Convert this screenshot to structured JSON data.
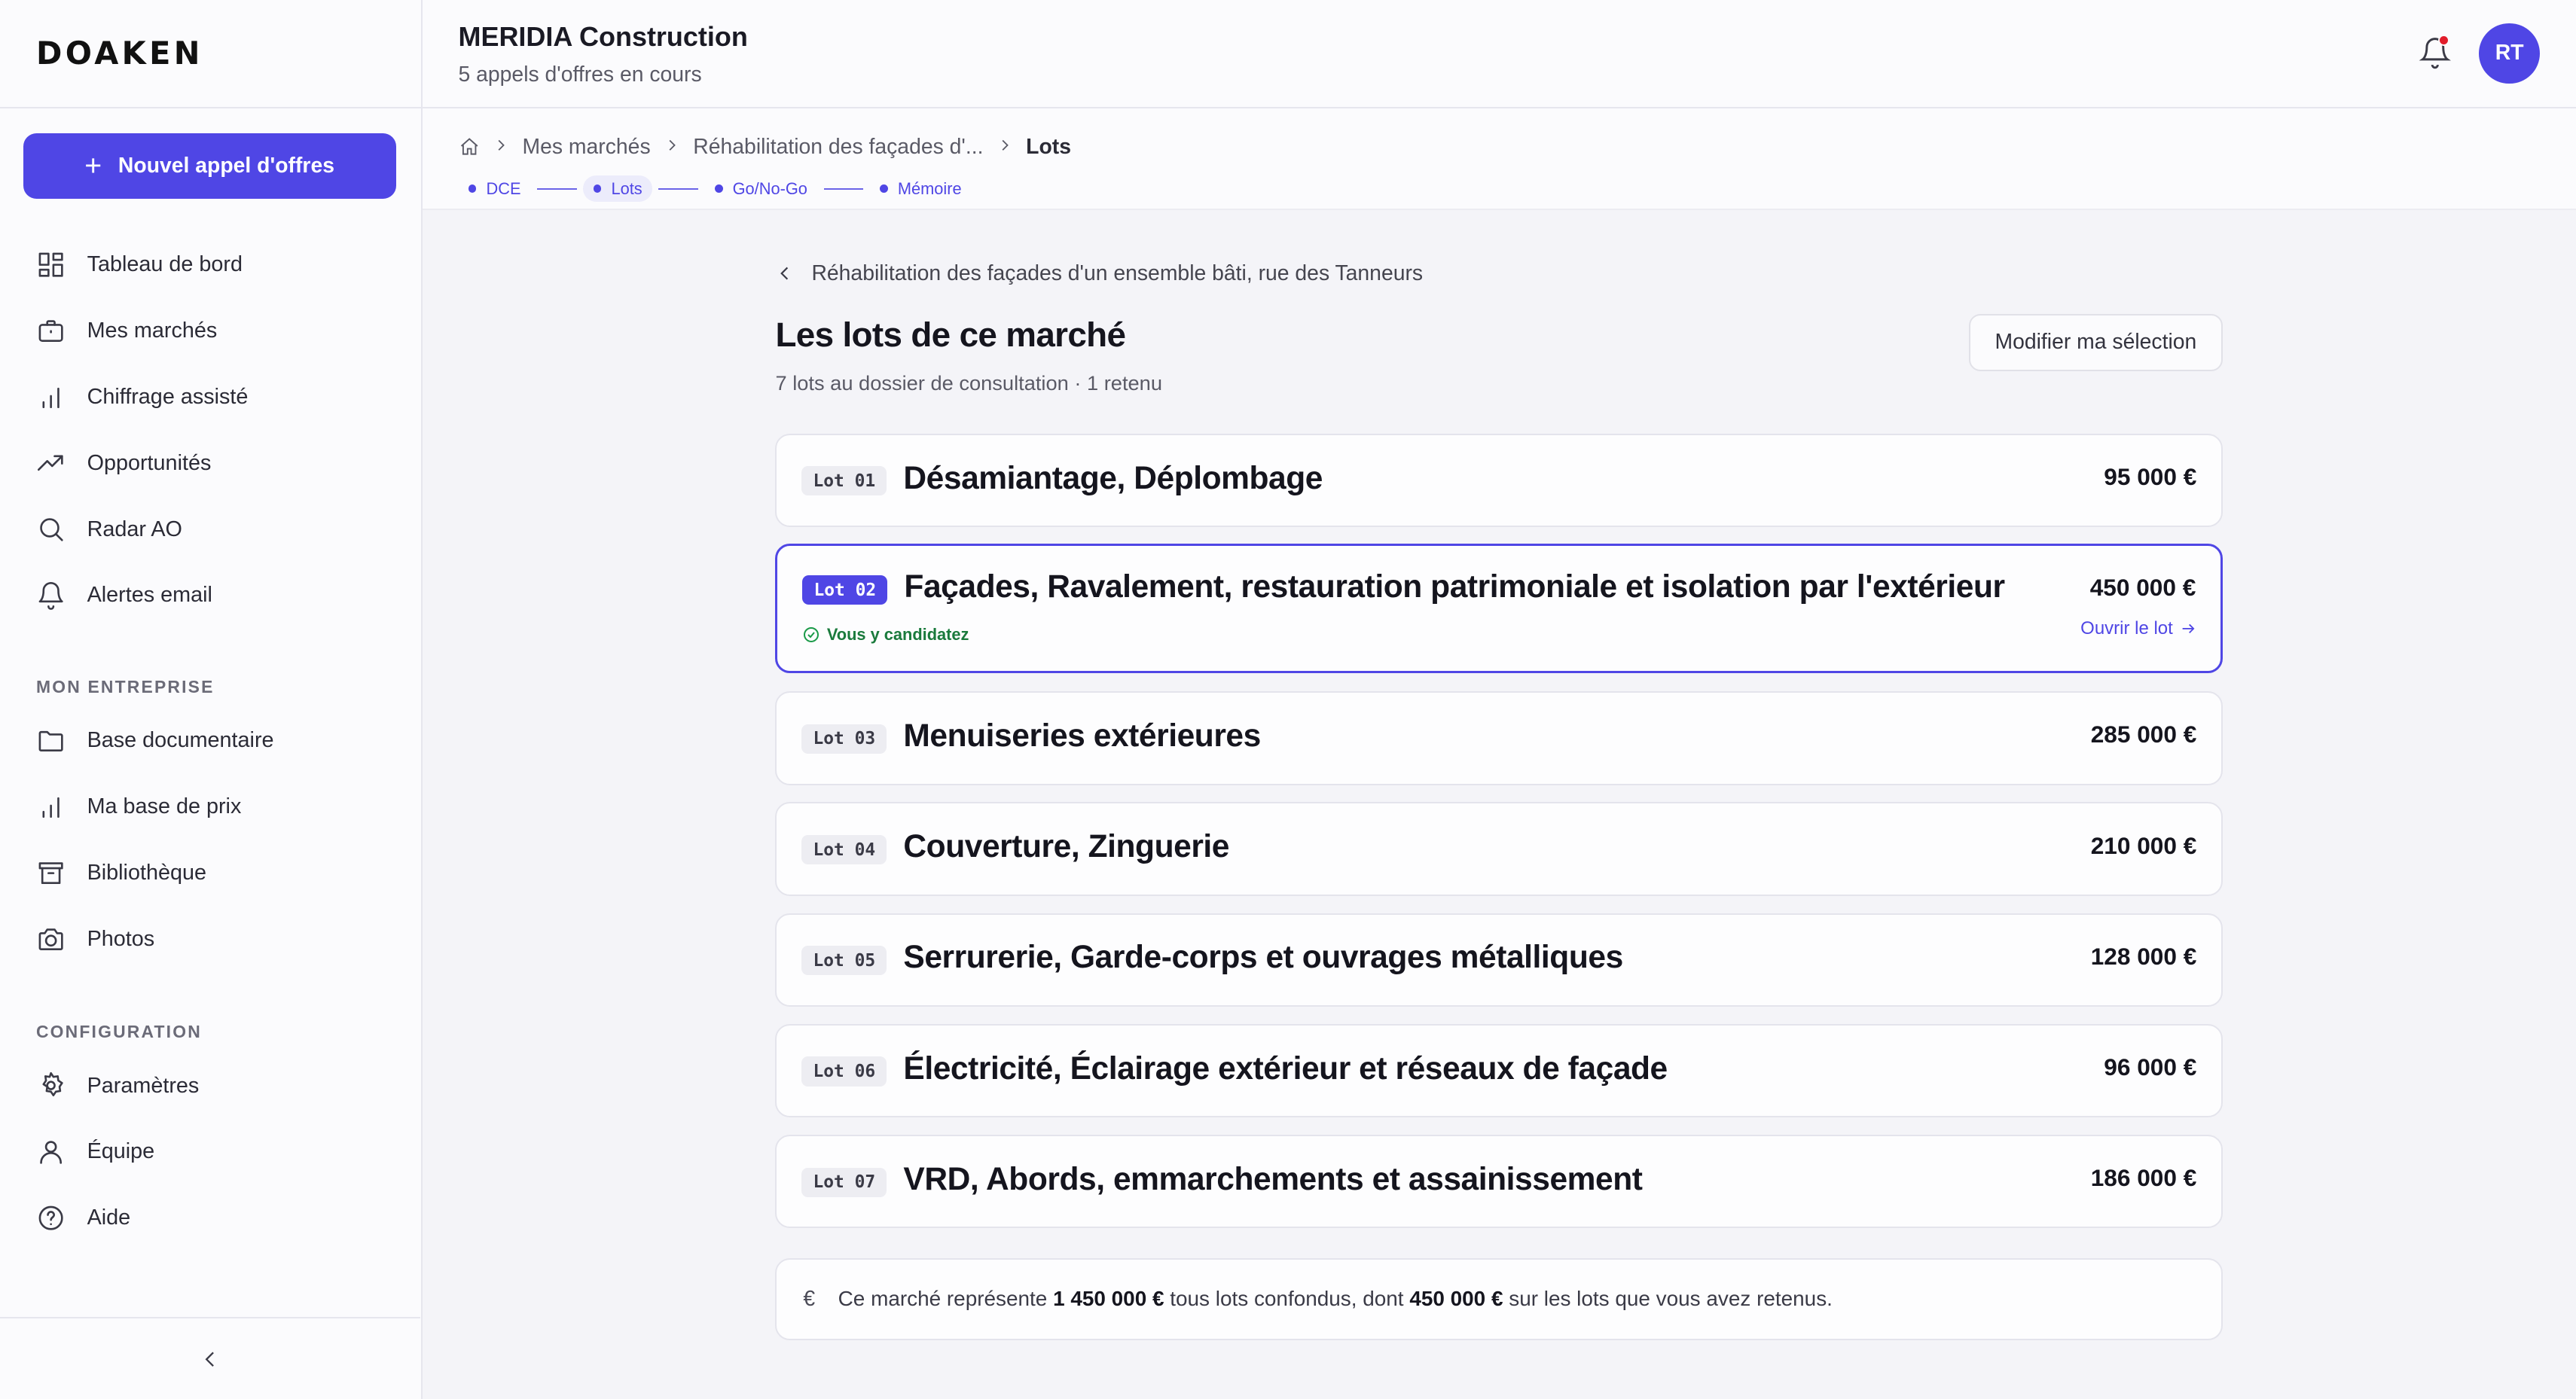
{
  "brand": {
    "logo": "DOAKEN"
  },
  "sidebar": {
    "new_button": "Nouvel appel d'offres",
    "main_items": [
      {
        "label": "Tableau de bord",
        "icon": "dashboard-icon"
      },
      {
        "label": "Mes marchés",
        "icon": "briefcase-icon"
      },
      {
        "label": "Chiffrage assisté",
        "icon": "bar-chart-icon"
      },
      {
        "label": "Opportunités",
        "icon": "trending-up-icon"
      },
      {
        "label": "Radar AO",
        "icon": "search-icon"
      },
      {
        "label": "Alertes email",
        "icon": "bell-icon"
      }
    ],
    "section_company": "MON ENTREPRISE",
    "company_items": [
      {
        "label": "Base documentaire",
        "icon": "folder-icon"
      },
      {
        "label": "Ma base de prix",
        "icon": "bar-chart-icon"
      },
      {
        "label": "Bibliothèque",
        "icon": "archive-icon"
      },
      {
        "label": "Photos",
        "icon": "camera-icon"
      }
    ],
    "section_config": "CONFIGURATION",
    "config_items": [
      {
        "label": "Paramètres",
        "icon": "gear-icon"
      },
      {
        "label": "Équipe",
        "icon": "user-icon"
      },
      {
        "label": "Aide",
        "icon": "help-icon"
      }
    ]
  },
  "header": {
    "company": "MERIDIA Construction",
    "subtitle": "5 appels d'offres en cours",
    "avatar_initials": "RT"
  },
  "breadcrumb": {
    "items": [
      "Mes marchés",
      "Réhabilitation des façades d'...",
      "Lots"
    ]
  },
  "steps": [
    "DCE",
    "Lots",
    "Go/No-Go",
    "Mémoire"
  ],
  "active_step": "Lots",
  "main": {
    "back_label": "Réhabilitation des façades d'un ensemble bâti, rue des Tanneurs",
    "title": "Les lots de ce marché",
    "subtitle": "7 lots au dossier de consultation · 1 retenu",
    "modify_button": "Modifier ma sélection"
  },
  "lots": [
    {
      "badge": "Lot 01",
      "name": "Désamiantage, Déplombage",
      "amount": "95 000 €"
    },
    {
      "badge": "Lot 02",
      "name": "Façades, Ravalement, restauration patrimoniale et isolation par l'extérieur",
      "amount": "450 000 €",
      "selected": true,
      "status": "Vous y candidatez",
      "action": "Ouvrir le lot"
    },
    {
      "badge": "Lot 03",
      "name": "Menuiseries extérieures",
      "amount": "285 000 €"
    },
    {
      "badge": "Lot 04",
      "name": "Couverture, Zinguerie",
      "amount": "210 000 €"
    },
    {
      "badge": "Lot 05",
      "name": "Serrurerie, Garde-corps et ouvrages métalliques",
      "amount": "128 000 €"
    },
    {
      "badge": "Lot 06",
      "name": "Électricité, Éclairage extérieur et réseaux de façade",
      "amount": "96 000 €"
    },
    {
      "badge": "Lot 07",
      "name": "VRD, Abords, emmarchements et assainissement",
      "amount": "186 000 €"
    }
  ],
  "summary": {
    "prefix": "Ce marché représente",
    "total": "1 450 000 €",
    "middle": "tous lots confondus, dont",
    "retained": "450 000 €",
    "suffix": "sur les lots que vous avez retenus."
  },
  "colors": {
    "accent": "#4f46e5",
    "success": "#1a9a48",
    "notification": "#e11d2b"
  }
}
